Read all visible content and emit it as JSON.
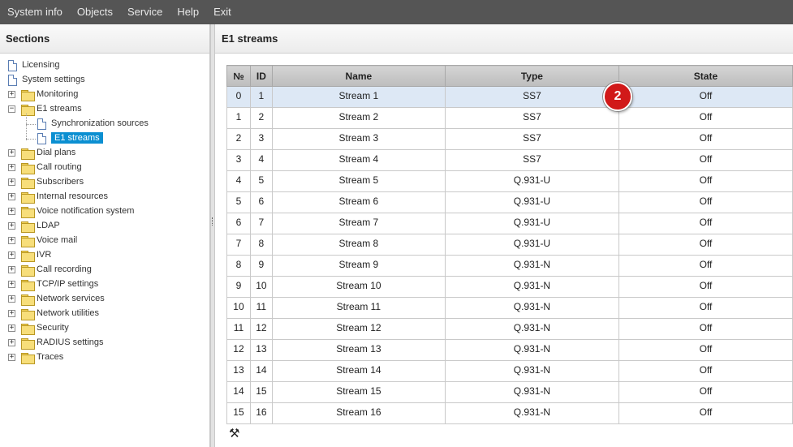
{
  "menu": [
    "System info",
    "Objects",
    "Service",
    "Help",
    "Exit"
  ],
  "sidebar": {
    "title": "Sections",
    "items": [
      {
        "label": "Licensing",
        "kind": "doc"
      },
      {
        "label": "System settings",
        "kind": "doc"
      },
      {
        "label": "Monitoring",
        "kind": "folder",
        "expanded": false
      },
      {
        "label": "E1 streams",
        "kind": "folder",
        "expanded": true
      },
      {
        "label": "Synchronization sources",
        "kind": "doc",
        "child": true
      },
      {
        "label": "E1 streams",
        "kind": "doc",
        "child": true,
        "selected": true
      },
      {
        "label": "Dial plans",
        "kind": "folder",
        "expanded": false
      },
      {
        "label": "Call routing",
        "kind": "folder",
        "expanded": false
      },
      {
        "label": "Subscribers",
        "kind": "folder",
        "expanded": false
      },
      {
        "label": "Internal resources",
        "kind": "folder",
        "expanded": false
      },
      {
        "label": "Voice notification system",
        "kind": "folder",
        "expanded": false
      },
      {
        "label": "LDAP",
        "kind": "folder",
        "expanded": false
      },
      {
        "label": "Voice mail",
        "kind": "folder",
        "expanded": false
      },
      {
        "label": "IVR",
        "kind": "folder",
        "expanded": false
      },
      {
        "label": "Call recording",
        "kind": "folder",
        "expanded": false
      },
      {
        "label": "TCP/IP settings",
        "kind": "folder",
        "expanded": false
      },
      {
        "label": "Network services",
        "kind": "folder",
        "expanded": false
      },
      {
        "label": "Network utilities",
        "kind": "folder",
        "expanded": false
      },
      {
        "label": "Security",
        "kind": "folder",
        "expanded": false
      },
      {
        "label": "RADIUS settings",
        "kind": "folder",
        "expanded": false
      },
      {
        "label": "Traces",
        "kind": "folder",
        "expanded": false
      }
    ]
  },
  "main": {
    "title": "E1 streams",
    "columns": [
      "№",
      "ID",
      "Name",
      "Type",
      "State"
    ],
    "rows": [
      [
        "0",
        "1",
        "Stream 1",
        "SS7",
        "Off"
      ],
      [
        "1",
        "2",
        "Stream 2",
        "SS7",
        "Off"
      ],
      [
        "2",
        "3",
        "Stream 3",
        "SS7",
        "Off"
      ],
      [
        "3",
        "4",
        "Stream 4",
        "SS7",
        "Off"
      ],
      [
        "4",
        "5",
        "Stream 5",
        "Q.931-U",
        "Off"
      ],
      [
        "5",
        "6",
        "Stream 6",
        "Q.931-U",
        "Off"
      ],
      [
        "6",
        "7",
        "Stream 7",
        "Q.931-U",
        "Off"
      ],
      [
        "7",
        "8",
        "Stream 8",
        "Q.931-U",
        "Off"
      ],
      [
        "8",
        "9",
        "Stream 9",
        "Q.931-N",
        "Off"
      ],
      [
        "9",
        "10",
        "Stream 10",
        "Q.931-N",
        "Off"
      ],
      [
        "10",
        "11",
        "Stream 11",
        "Q.931-N",
        "Off"
      ],
      [
        "11",
        "12",
        "Stream 12",
        "Q.931-N",
        "Off"
      ],
      [
        "12",
        "13",
        "Stream 13",
        "Q.931-N",
        "Off"
      ],
      [
        "13",
        "14",
        "Stream 14",
        "Q.931-N",
        "Off"
      ],
      [
        "14",
        "15",
        "Stream 15",
        "Q.931-N",
        "Off"
      ],
      [
        "15",
        "16",
        "Stream 16",
        "Q.931-N",
        "Off"
      ]
    ],
    "selected_row": 0,
    "badge": "2",
    "tools_icon": "tools-icon"
  },
  "colors": {
    "menubar": "#555555",
    "selection": "#0b8fd1",
    "row_highlight": "#dde8f5",
    "badge": "#d11919"
  }
}
